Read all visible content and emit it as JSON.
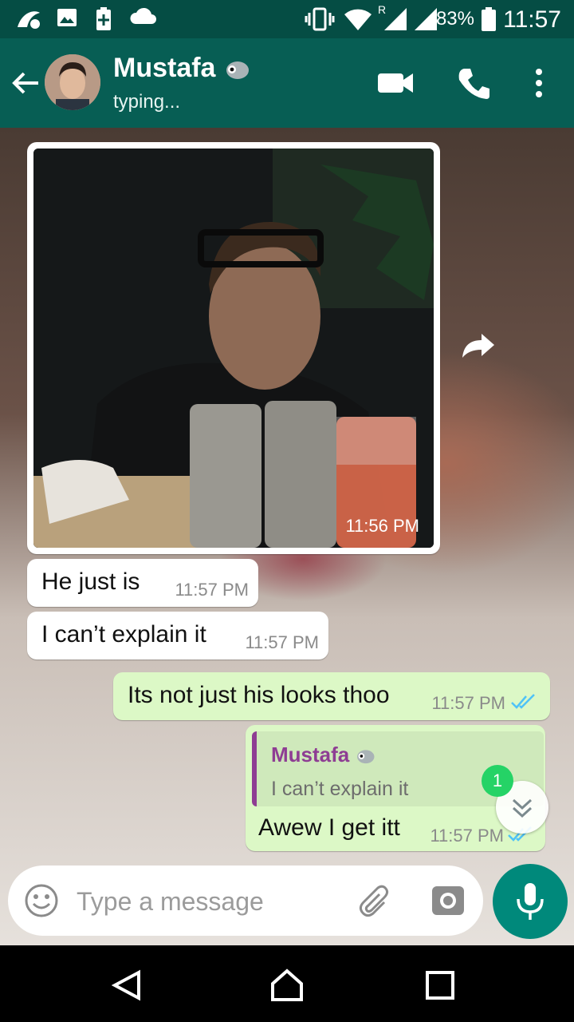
{
  "status_bar": {
    "battery": "83%",
    "time": "11:57",
    "network_label": "R"
  },
  "header": {
    "contact_name": "Mustafa",
    "contact_status": "typing..."
  },
  "messages": [
    {
      "type": "image",
      "direction": "incoming",
      "time": "11:56 PM"
    },
    {
      "type": "text",
      "direction": "incoming",
      "text": "He just is",
      "time": "11:57 PM"
    },
    {
      "type": "text",
      "direction": "incoming",
      "text": "I can’t explain it",
      "time": "11:57 PM"
    },
    {
      "type": "text",
      "direction": "outgoing",
      "text": "Its not just his looks thoo",
      "time": "11:57 PM",
      "ticks": "read"
    },
    {
      "type": "reply",
      "direction": "outgoing",
      "quoted_name": "Mustafa",
      "quoted_text": "I can’t explain it",
      "text": "Awew I get itt",
      "time": "11:57 PM",
      "ticks": "read"
    }
  ],
  "unread_count": "1",
  "composer": {
    "placeholder": "Type a message"
  },
  "colors": {
    "header": "#075e54",
    "status_bar": "#054d44",
    "outgoing_bubble": "#dcf8c6",
    "incoming_bubble": "#ffffff",
    "read_ticks": "#4fc3f7",
    "quote_name": "#8e3d93",
    "mic_button": "#00897b",
    "badge": "#25d366"
  },
  "icons": [
    "navigation-icon",
    "gallery-icon",
    "battery-saver-icon",
    "cloud-icon",
    "vibrate-icon",
    "wifi-icon",
    "signal-icon",
    "battery-icon",
    "back-arrow-icon",
    "parrot-emoji-icon",
    "video-call-icon",
    "phone-icon",
    "more-vert-icon",
    "forward-icon",
    "double-check-icon",
    "chevron-double-down-icon",
    "emoji-icon",
    "paperclip-icon",
    "camera-icon",
    "mic-icon",
    "nav-back-icon",
    "nav-home-icon",
    "nav-recents-icon"
  ]
}
